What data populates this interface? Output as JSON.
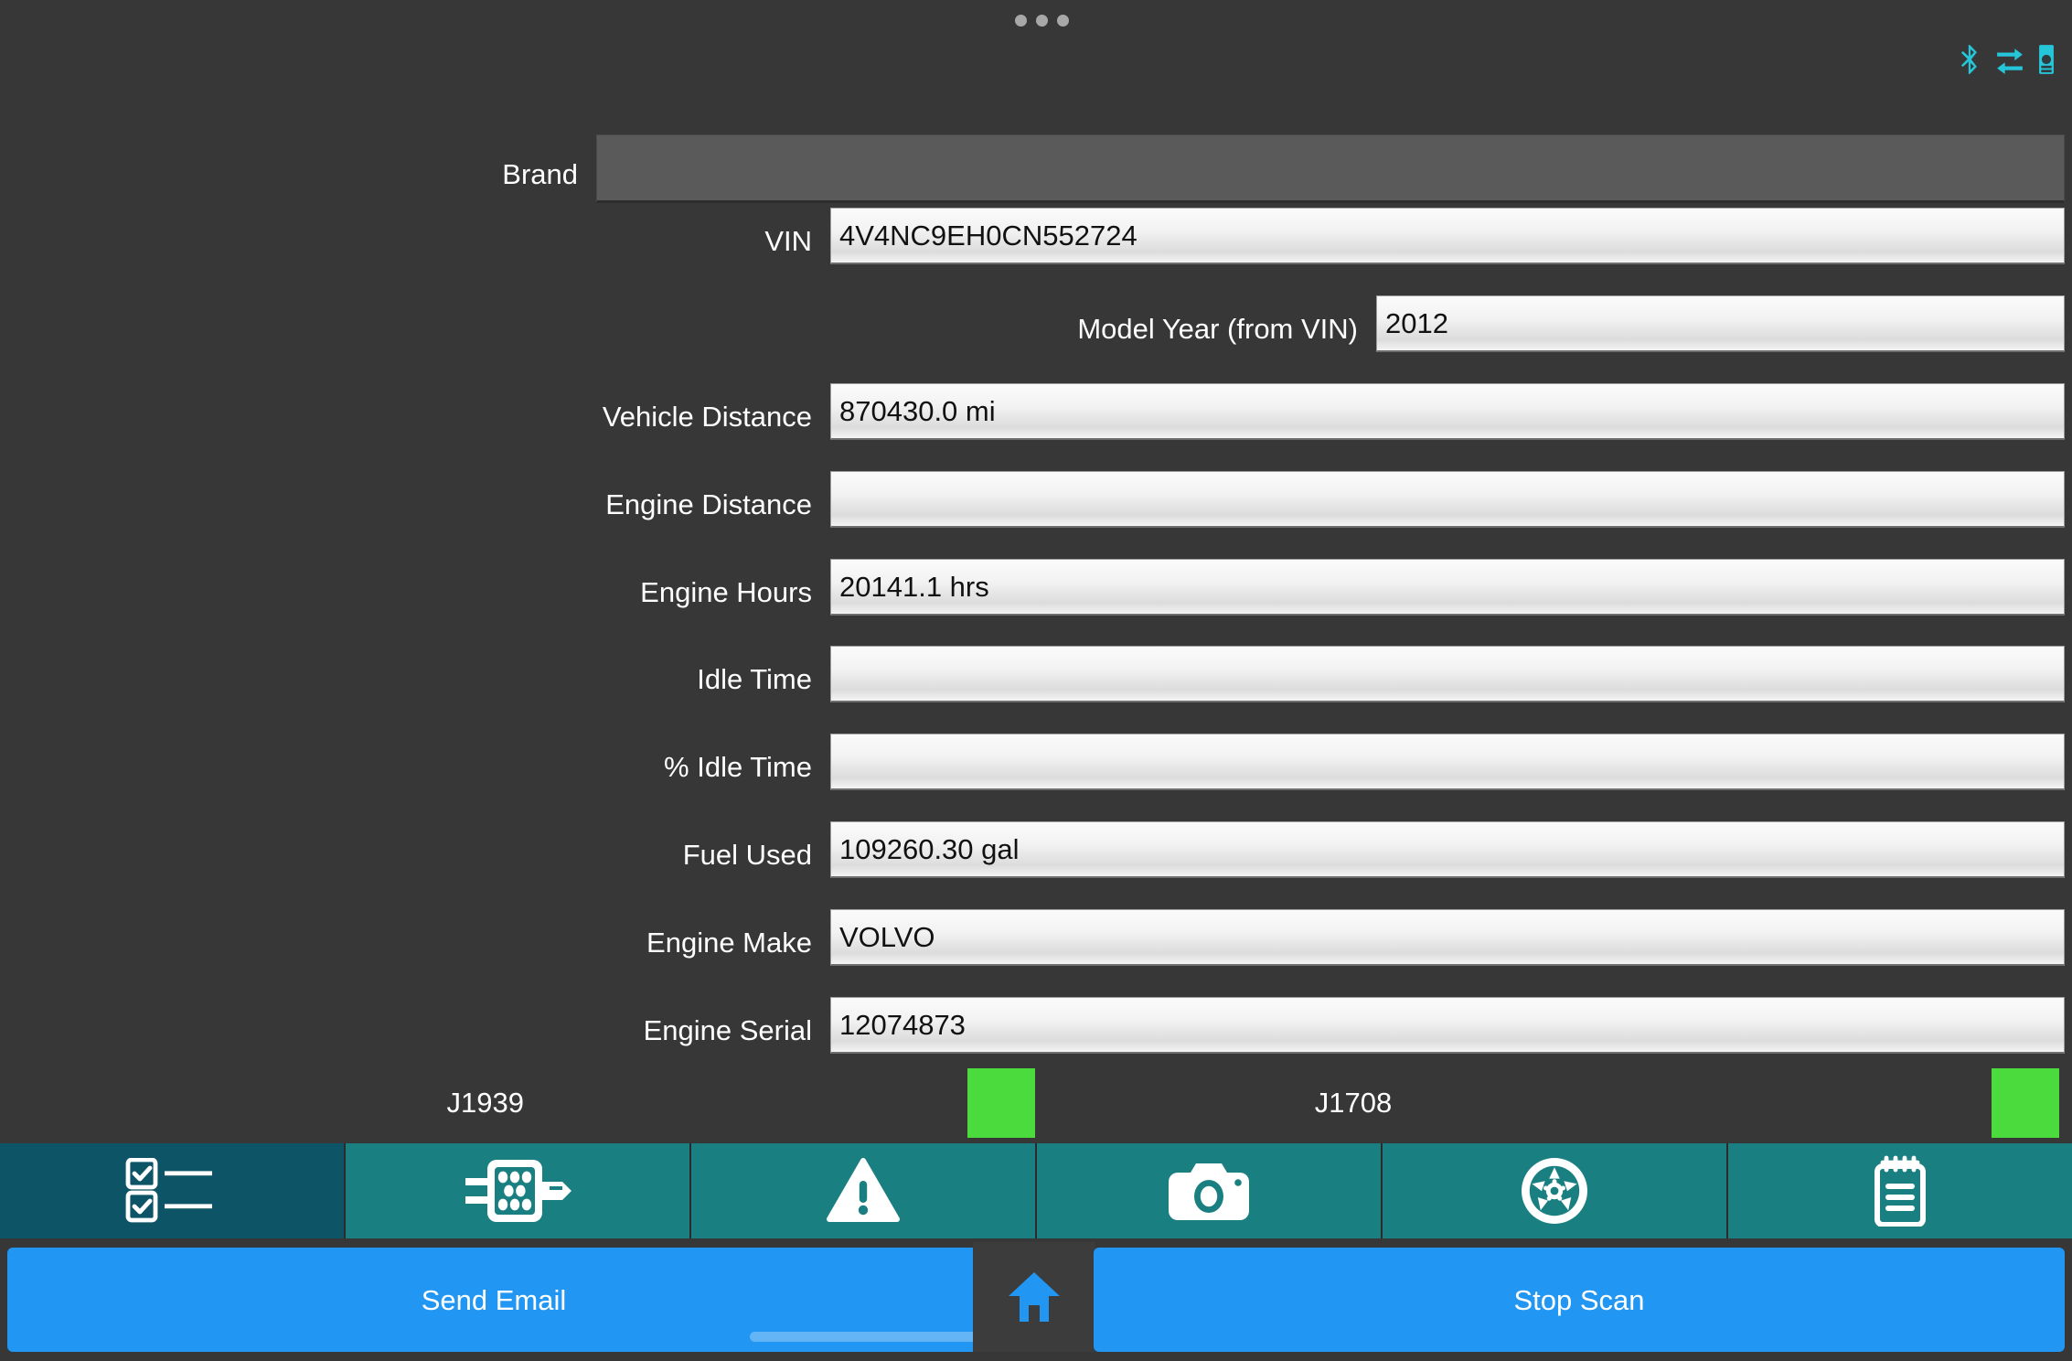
{
  "app": {
    "background_color": "#373737",
    "accent_blue": "#2196f3",
    "tab_teal": "#1a7f80",
    "tab_teal_selected": "#0d5566",
    "status_green": "#4cdb3c",
    "status_icon_color": "#26c6da"
  },
  "topbar": {
    "overflow_menu": "•••",
    "icons": [
      {
        "name": "bluetooth-icon",
        "label": "Bluetooth"
      },
      {
        "name": "data-transfer-icon",
        "label": "Data Transfer"
      },
      {
        "name": "device-battery-icon",
        "label": "Device"
      }
    ]
  },
  "form": {
    "rows": [
      {
        "label": "Brand",
        "value": "",
        "type": "spinner"
      },
      {
        "label": "VIN",
        "value": "4V4NC9EH0CN552724",
        "type": "text"
      },
      {
        "label": "Model Year (from VIN)",
        "value": "2012",
        "type": "text"
      },
      {
        "label": "Vehicle Distance",
        "value": "870430.0 mi",
        "type": "text"
      },
      {
        "label": "Engine Distance",
        "value": "",
        "type": "text"
      },
      {
        "label": "Engine Hours",
        "value": "20141.1 hrs",
        "type": "text"
      },
      {
        "label": "Idle Time",
        "value": "",
        "type": "text"
      },
      {
        "label": "% Idle Time",
        "value": "",
        "type": "text"
      },
      {
        "label": "Fuel Used",
        "value": "109260.30 gal",
        "type": "text"
      },
      {
        "label": "Engine Make",
        "value": "VOLVO",
        "type": "text"
      },
      {
        "label": "Engine Serial",
        "value": "12074873",
        "type": "text"
      }
    ]
  },
  "bus_status": {
    "j1939_label": "J1939",
    "j1939_state": "active",
    "j1708_label": "J1708",
    "j1708_state": "active"
  },
  "tabs": [
    {
      "name": "tab-checklist",
      "icon": "checklist-icon",
      "selected": true
    },
    {
      "name": "tab-connector",
      "icon": "connector-icon",
      "selected": false
    },
    {
      "name": "tab-faults",
      "icon": "warning-icon",
      "selected": false
    },
    {
      "name": "tab-camera",
      "icon": "camera-icon",
      "selected": false
    },
    {
      "name": "tab-wheels",
      "icon": "wheel-icon",
      "selected": false
    },
    {
      "name": "tab-notes",
      "icon": "notepad-icon",
      "selected": false
    }
  ],
  "actions": {
    "send_email_label": "Send Email",
    "home_icon": "home-icon",
    "stop_scan_label": "Stop Scan"
  }
}
